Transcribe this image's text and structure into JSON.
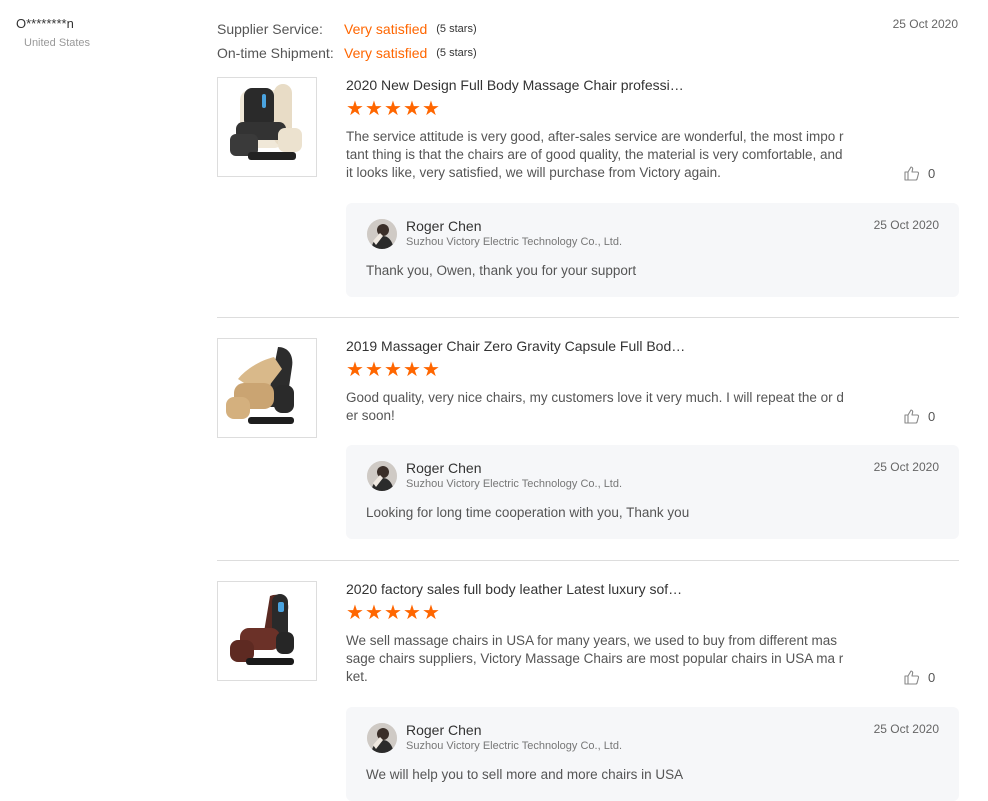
{
  "reviewer": {
    "name": "O********n",
    "country": "United States"
  },
  "ratings": [
    {
      "label": "Supplier Service:",
      "value": "Very satisfied",
      "count": "(5 stars)"
    },
    {
      "label": "On-time Shipment:",
      "value": "Very satisfied",
      "count": "(5 stars)"
    }
  ],
  "review_date": "25 Oct 2020",
  "colors": {
    "accent": "#ff6600",
    "reply_bg": "#f6f7f9",
    "divider": "#dddddd"
  },
  "icons": {
    "star": "star-icon",
    "like": "thumbs-up-icon"
  },
  "reviews": [
    {
      "title": "2020 New Design Full Body Massage Chair professi…",
      "stars": 5,
      "comment": "The service attitude is very good, after-sales service are wonderful, the most impo rtant thing is that the chairs are of good quality, the material is very comfortable, and it looks like, very satisfied, we will purchase from Victory again.",
      "likes": "0",
      "reply": {
        "name": "Roger Chen",
        "company": "Suzhou Victory Electric Technology Co., Ltd.",
        "date": "25 Oct 2020",
        "text": "Thank you, Owen, thank you for your support"
      }
    },
    {
      "title": "2019 Massager Chair Zero Gravity Capsule Full Bod…",
      "stars": 5,
      "comment": "Good quality, very nice chairs, my customers love it very much. I will repeat the or der soon!",
      "likes": "0",
      "reply": {
        "name": "Roger Chen",
        "company": "Suzhou Victory Electric Technology Co., Ltd.",
        "date": "25 Oct 2020",
        "text": "Looking for long time cooperation with you, Thank you"
      }
    },
    {
      "title": "2020 factory sales full body leather Latest luxury sof…",
      "stars": 5,
      "comment": "We sell massage chairs in USA for many years, we used to buy from different mas sage chairs suppliers, Victory Massage Chairs are most popular chairs in USA ma rket.",
      "likes": "0",
      "reply": {
        "name": "Roger Chen",
        "company": "Suzhou Victory Electric Technology Co., Ltd.",
        "date": "25 Oct 2020",
        "text": "We will help you to sell more and more chairs in USA"
      }
    }
  ]
}
